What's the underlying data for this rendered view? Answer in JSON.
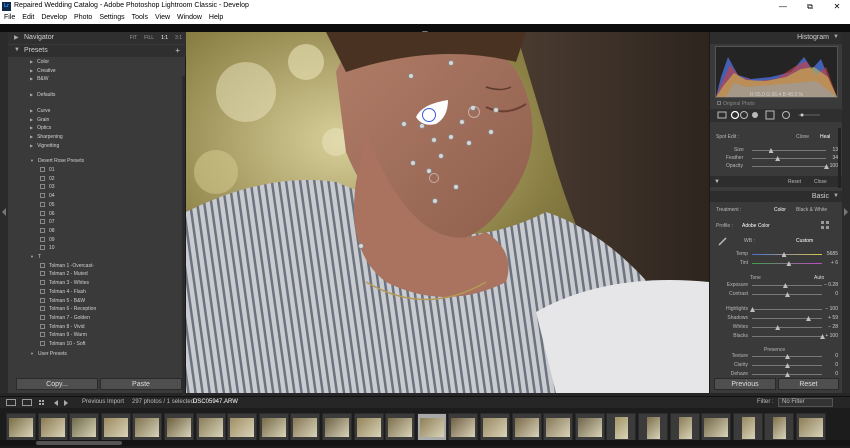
{
  "window": {
    "title": "Repaired Wedding Catalog - Adobe Photoshop Lightroom Classic - Develop",
    "app_icon": "Lr",
    "minimize_glyph": "—",
    "restore_glyph": "⧉",
    "close_glyph": "✕"
  },
  "menu": [
    "File",
    "Edit",
    "Develop",
    "Photo",
    "Settings",
    "Tools",
    "View",
    "Window",
    "Help"
  ],
  "left_panel": {
    "navigator": {
      "label": "Navigator",
      "options": [
        "FIT",
        "FILL",
        "1:1",
        "3:1"
      ]
    },
    "presets": {
      "label": "Presets",
      "add": "+"
    },
    "groups_a": [
      "Color",
      "Creative",
      "B&W"
    ],
    "groups_b": [
      "Defaults"
    ],
    "groups_c": [
      "Curve",
      "Grain",
      "Optics",
      "Sharpening",
      "Vignetting"
    ],
    "desert_rose": {
      "label": "Desert Rose Presets",
      "items": [
        "01",
        "02",
        "03",
        "04",
        "05",
        "06",
        "07",
        "08",
        "09",
        "10"
      ]
    },
    "t_group": {
      "label": "T",
      "items": [
        "Tolman 1 -Overcast-",
        "Tolman 2 - Muted",
        "Tolman 3 - Whites",
        "Tolman 4 - Flash",
        "Tolman 5 - B&W",
        "Tolman 6 - Reception",
        "Tolman 7 - Golden",
        "Tolman 8 - Vivid",
        "Tolman 9 - Warm",
        "Tolman 10 - Soft"
      ]
    },
    "user_presets": "User Presets",
    "copy_button": "Copy...",
    "paste_button": "Paste"
  },
  "right_panel": {
    "histogram": {
      "label": "Histogram",
      "readout": [
        "R",
        "65.0",
        "G",
        "56.4",
        "B",
        "48.3",
        "%"
      ],
      "original_photo": "Original Photo"
    },
    "spot": {
      "label": "Spot Edit :",
      "modes": [
        "Clone",
        "Heal"
      ],
      "size_label": "Size",
      "size_value": "13",
      "feather_label": "Feather",
      "feather_value": "34",
      "opacity_label": "Opacity",
      "opacity_value": "100",
      "size_level": 0.25,
      "feather_level": 0.34,
      "opacity_level": 1.0
    },
    "spot_footer": {
      "reset": "Reset",
      "close": "Close"
    },
    "basic": {
      "label": "Basic",
      "treatment_label": "Treatment :",
      "treatment_color": "Color",
      "treatment_bw": "Black & White",
      "profile_label": "Profile :",
      "profile_value": "Adobe Color",
      "wb_label": "WB :",
      "wb_value": "Custom",
      "tone_label": "Tone",
      "tone_auto": "Auto",
      "presence_label": "Presence",
      "sliders": [
        {
          "label": "Temp",
          "value": "5685",
          "level": 0.45
        },
        {
          "label": "Tint",
          "value": "+ 6",
          "level": 0.52
        },
        {
          "label": "Exposure",
          "value": "− 0.28",
          "level": 0.47
        },
        {
          "label": "Contrast",
          "value": "0",
          "level": 0.5
        },
        {
          "label": "Highlights",
          "value": "− 100",
          "level": 0.0
        },
        {
          "label": "Shadows",
          "value": "+ 59",
          "level": 0.8
        },
        {
          "label": "Whites",
          "value": "− 28",
          "level": 0.36
        },
        {
          "label": "Blacks",
          "value": "+ 100",
          "level": 1.0
        },
        {
          "label": "Texture",
          "value": "0",
          "level": 0.5
        },
        {
          "label": "Clarity",
          "value": "0",
          "level": 0.5
        },
        {
          "label": "Dehaze",
          "value": "0",
          "level": 0.5
        }
      ]
    },
    "previous_button": "Previous",
    "reset_button": "Reset"
  },
  "status_bar": {
    "source": "Previous Import",
    "count": "297 photos / 1 selected /",
    "filename": "DSC05947.ARW",
    "filter_label": "Filter :",
    "filter_value": "No Filter"
  },
  "colors": {
    "panel_bg": "#3a3a3a",
    "header_bg": "#2f2f2f",
    "filmstrip_bg": "#1c1c1c",
    "selected_thumb": "#aaaaaa"
  }
}
